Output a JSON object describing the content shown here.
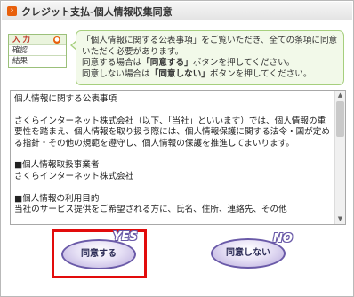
{
  "window": {
    "title": "クレジット支払-個人情報収集同意",
    "title_icon": "orange-square-icon"
  },
  "steps": {
    "items": [
      {
        "label": "入 力",
        "active": true
      },
      {
        "label": "確認",
        "active": false
      },
      {
        "label": "結果",
        "active": false
      }
    ],
    "active_marker": "●"
  },
  "instruction": {
    "line1": "「個人情報に関する公表事項」をご覧いただき、全ての条項に同意いただく必要があります。",
    "line2_prefix": "同意する場合は",
    "line2_bold": "「同意する」",
    "line2_suffix": "ボタンを押してください。",
    "line3_prefix": "同意しない場合は",
    "line3_bold": "「同意しない」",
    "line3_suffix": "ボタンを押してください。"
  },
  "policy": {
    "heading": "個人情報に関する公表事項",
    "para1": "さくらインターネット株式会社（以下、「当社」といいます）では、個人情報の重要性を踏まえ、個人情報を取り扱う際には、個人情報保護に関する法令・国が定める指針・その他の規範を遵守し、個人情報の保護を推進してまいります。",
    "section1_title": "■個人情報取扱事業者",
    "section1_body": "さくらインターネット株式会社",
    "section2_title": "■個人情報の利用目的",
    "section2_body": "当社のサービス提供をご希望される方に、氏名、住所、連絡先、その他"
  },
  "buttons": {
    "agree_label": "同意する",
    "agree_tag": "YES",
    "disagree_label": "同意しない",
    "disagree_tag": "NO"
  },
  "colors": {
    "accent_orange": "#e8600c",
    "highlight_red": "#e20c0c",
    "button_purple": "#6a5aa8",
    "info_green": "#a6cf7d"
  }
}
